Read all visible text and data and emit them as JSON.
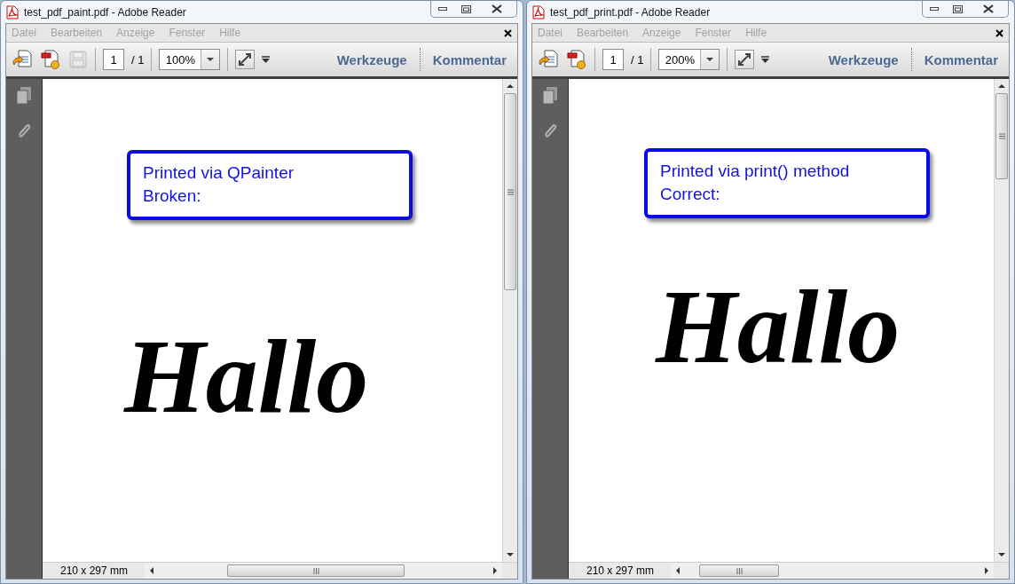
{
  "windows": [
    {
      "title": "test_pdf_paint.pdf - Adobe Reader",
      "menu": [
        "Datei",
        "Bearbeiten",
        "Anzeige",
        "Fenster",
        "Hilfe"
      ],
      "save_button": {
        "disabled": true
      },
      "page_field": "1",
      "page_total": "/ 1",
      "zoom": "100%",
      "tools": "Werkzeuge",
      "comment": "Kommentar",
      "document": {
        "note_lines": [
          "Printed via QPainter",
          "Broken:"
        ],
        "word": "Hallo"
      },
      "page_size": "210 x 297 mm"
    },
    {
      "title": "test_pdf_print.pdf - Adobe Reader",
      "menu": [
        "Datei",
        "Bearbeiten",
        "Anzeige",
        "Fenster",
        "Hilfe"
      ],
      "page_field": "1",
      "page_total": "/ 1",
      "zoom": "200%",
      "tools": "Werkzeuge",
      "comment": "Kommentar",
      "document": {
        "note_lines": [
          "Printed via print() method",
          "Correct:"
        ],
        "word": "Hallo"
      },
      "page_size": "210 x 297 mm"
    }
  ]
}
